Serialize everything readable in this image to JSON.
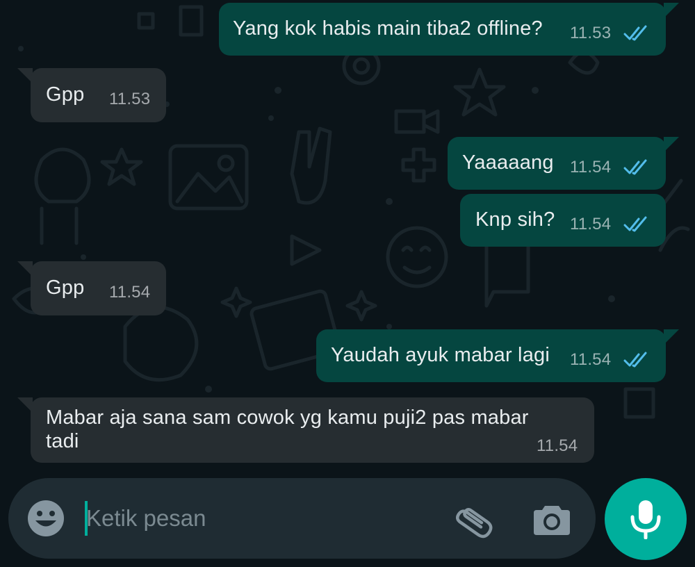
{
  "messages": [
    {
      "text": "Yang kok habis main tiba2 offline?",
      "time": "11.53",
      "direction": "outgoing",
      "status": "read"
    },
    {
      "text": "Gpp",
      "time": "11.53",
      "direction": "incoming"
    },
    {
      "text": "Yaaaaang",
      "time": "11.54",
      "direction": "outgoing",
      "status": "read"
    },
    {
      "text": "Knp sih?",
      "time": "11.54",
      "direction": "outgoing",
      "status": "read"
    },
    {
      "text": "Gpp",
      "time": "11.54",
      "direction": "incoming"
    },
    {
      "text": "Yaudah ayuk mabar lagi",
      "time": "11.54",
      "direction": "outgoing",
      "status": "read"
    },
    {
      "text_line1": "Mabar aja sana sam cowok yg kamu puji2 pas mabar",
      "text_line2": "tadi",
      "time": "11.54",
      "direction": "incoming"
    }
  ],
  "composer": {
    "placeholder": "Ketik pesan",
    "value": "",
    "icons": {
      "emoji": "emoji-icon",
      "attach": "paperclip-icon",
      "camera": "camera-icon",
      "mic": "microphone-icon"
    }
  },
  "colors": {
    "background": "#0b1419",
    "outgoing_bubble": "#054640",
    "incoming_bubble": "#262d31",
    "read_ticks": "#53bdeb",
    "accent": "#00af9c",
    "composer": "#1f2c33"
  }
}
